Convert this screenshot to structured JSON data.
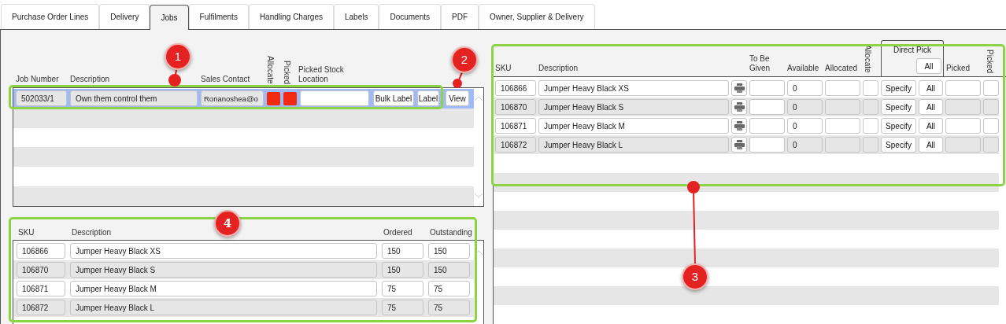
{
  "tabs": [
    {
      "label": "Purchase Order Lines",
      "selected": false
    },
    {
      "label": "Delivery",
      "selected": false
    },
    {
      "label": "Jobs",
      "selected": true
    },
    {
      "label": "Fulfilments",
      "selected": false
    },
    {
      "label": "Handling Charges",
      "selected": false
    },
    {
      "label": "Labels",
      "selected": false
    },
    {
      "label": "Documents",
      "selected": false
    },
    {
      "label": "PDF",
      "selected": false
    },
    {
      "label": "Owner, Supplier & Delivery",
      "selected": false
    }
  ],
  "jobs": {
    "columns": [
      "Job Number",
      "Description",
      "Sales Contact",
      "Allocate",
      "Picked",
      "Picked Stock Location"
    ],
    "rows": [
      {
        "job_number": "502033/1",
        "description": "Own them control them",
        "sales_contact": "Ronanoshea@o",
        "allocated": false,
        "picked": false,
        "selected": true,
        "buttons": [
          "Bulk Label",
          "Label",
          "View"
        ]
      }
    ]
  },
  "order_lines": {
    "columns": [
      "SKU",
      "Description",
      "Ordered",
      "Outstanding"
    ],
    "rows": [
      {
        "sku": "106866",
        "description": "Jumper Heavy Black XS",
        "ordered": "150",
        "outstanding": "150",
        "disabled": false
      },
      {
        "sku": "106870",
        "description": "Jumper Heavy Black S",
        "ordered": "150",
        "outstanding": "150",
        "disabled": true
      },
      {
        "sku": "106871",
        "description": "Jumper Heavy Black M",
        "ordered": "75",
        "outstanding": "75",
        "disabled": false
      },
      {
        "sku": "106872",
        "description": "Jumper Heavy Black L",
        "ordered": "75",
        "outstanding": "75",
        "disabled": true
      }
    ]
  },
  "job_lines": {
    "columns": [
      "SKU",
      "Description",
      "To Be Given",
      "Available",
      "Allocated",
      "Allocate",
      "Picked",
      "Picked"
    ],
    "direct_pick": {
      "label": "Direct Pick",
      "button": "All"
    },
    "rows": [
      {
        "sku": "106866",
        "description": "Jumper Heavy Black XS",
        "available": "0",
        "disabled": false,
        "buttons": [
          "Specify",
          "All"
        ]
      },
      {
        "sku": "106870",
        "description": "Jumper Heavy Black S",
        "available": "0",
        "disabled": true,
        "buttons": [
          "Specify",
          "All"
        ]
      },
      {
        "sku": "106871",
        "description": "Jumper Heavy Black M",
        "available": "0",
        "disabled": false,
        "buttons": [
          "Specify",
          "All"
        ]
      },
      {
        "sku": "106872",
        "description": "Jumper Heavy Black L",
        "available": "0",
        "disabled": true,
        "buttons": [
          "Specify",
          "All"
        ]
      }
    ]
  },
  "annotations": [
    {
      "label": "1"
    },
    {
      "label": "2"
    },
    {
      "label": "3"
    },
    {
      "label": "4"
    }
  ]
}
